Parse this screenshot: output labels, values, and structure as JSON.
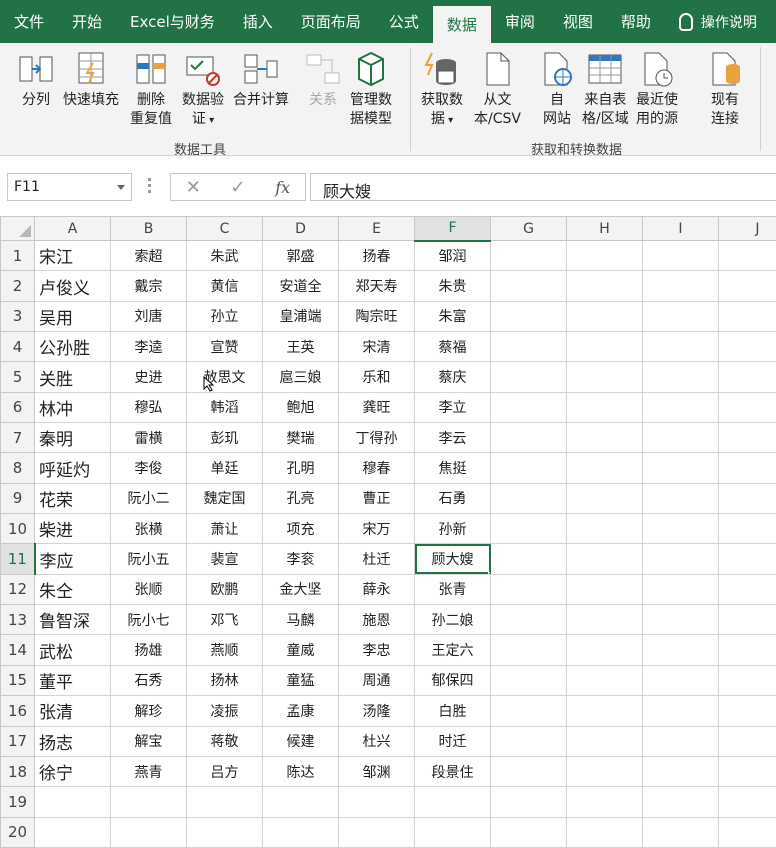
{
  "menu": {
    "tabs": [
      "文件",
      "开始",
      "Excel与财务",
      "插入",
      "页面布局",
      "公式",
      "数据",
      "审阅",
      "视图",
      "帮助"
    ],
    "active_index": 6,
    "help_search": "操作说明"
  },
  "ribbon": {
    "group_data_tools": {
      "label": "数据工具",
      "buttons": [
        "分列",
        "快速填充",
        "删除\n重复值",
        "数据验\n证",
        "合并计算",
        "关系",
        "管理数\n据模型"
      ]
    },
    "group_get_data": {
      "label": "获取和转换数据",
      "buttons": [
        "获取数\n据",
        "从文\n本/CSV",
        "自\n网站",
        "来自表\n格/区域",
        "最近使\n用的源",
        "现有\n连接"
      ]
    }
  },
  "formula_bar": {
    "name_box": "F11",
    "value": "顾大嫂"
  },
  "grid": {
    "columns": [
      "A",
      "B",
      "C",
      "D",
      "E",
      "F",
      "G",
      "H",
      "I",
      "J"
    ],
    "active_cell": "F11",
    "rows": [
      [
        "宋江",
        "索超",
        "朱武",
        "郭盛",
        "扬春",
        "邹润"
      ],
      [
        "卢俊义",
        "戴宗",
        "黄信",
        "安道全",
        "郑天寿",
        "朱贵"
      ],
      [
        "吴用",
        "刘唐",
        "孙立",
        "皇浦端",
        "陶宗旺",
        "朱富"
      ],
      [
        "公孙胜",
        "李逵",
        "宣赞",
        "王英",
        "宋清",
        "蔡福"
      ],
      [
        "关胜",
        "史进",
        "赦思文",
        "扈三娘",
        "乐和",
        "蔡庆"
      ],
      [
        "林冲",
        "穆弘",
        "韩滔",
        "鲍旭",
        "龚旺",
        "李立"
      ],
      [
        "秦明",
        "雷横",
        "彭玑",
        "樊瑞",
        "丁得孙",
        "李云"
      ],
      [
        "呼延灼",
        "李俊",
        "单廷",
        "孔明",
        "穆春",
        "焦挺"
      ],
      [
        "花荣",
        "阮小二",
        "魏定国",
        "孔亮",
        "曹正",
        "石勇"
      ],
      [
        "柴进",
        "张横",
        "萧让",
        "项充",
        "宋万",
        "孙新"
      ],
      [
        "李应",
        "阮小五",
        "裴宣",
        "李衮",
        "杜迁",
        "顾大嫂"
      ],
      [
        "朱仝",
        "张顺",
        "欧鹏",
        "金大坚",
        "薛永",
        "张青"
      ],
      [
        "鲁智深",
        "阮小七",
        "邓飞",
        "马麟",
        "施恩",
        "孙二娘"
      ],
      [
        "武松",
        "扬雄",
        "燕顺",
        "童威",
        "李忠",
        "王定六"
      ],
      [
        "董平",
        "石秀",
        "扬林",
        "童猛",
        "周通",
        "郁保四"
      ],
      [
        "张清",
        "解珍",
        "凌振",
        "孟康",
        "汤隆",
        "白胜"
      ],
      [
        "扬志",
        "解宝",
        "蒋敬",
        "候建",
        "杜兴",
        "时迁"
      ],
      [
        "徐宁",
        "燕青",
        "吕方",
        "陈达",
        "邹渊",
        "段景住"
      ],
      [
        "",
        "",
        "",
        "",
        "",
        ""
      ],
      [
        "",
        "",
        "",
        "",
        "",
        ""
      ]
    ]
  },
  "colors": {
    "accent": "#217346",
    "ribbon_bg": "#f3f3f3"
  }
}
